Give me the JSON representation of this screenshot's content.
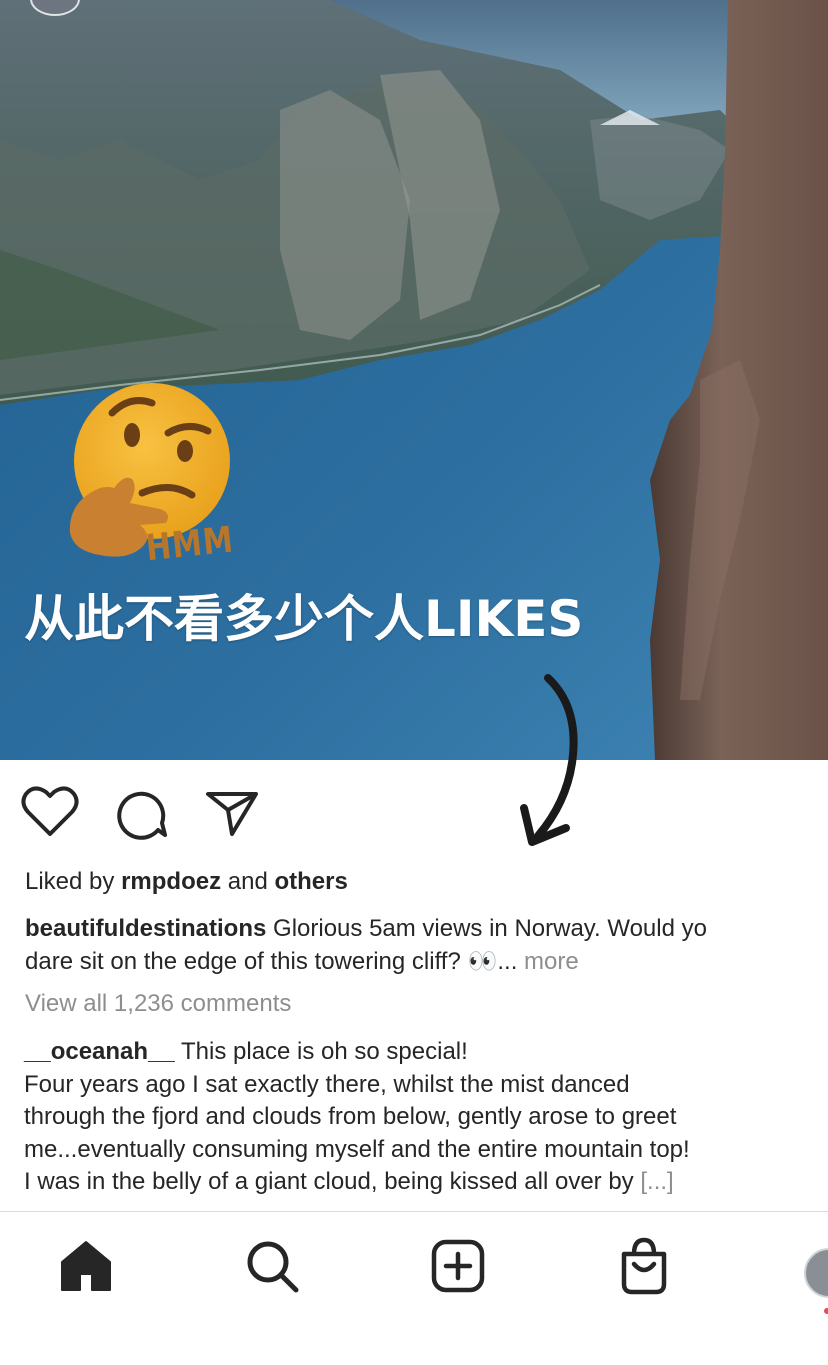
{
  "post": {
    "overlay_caption": "从此不看多少个人LIKES",
    "sticker_text": "HMM",
    "liked_by_prefix": "Liked by",
    "liked_by_user": "rmpdoez",
    "liked_by_and": "and",
    "liked_by_others": "others",
    "caption_user": "beautifuldestinations",
    "caption_line1": "Glorious 5am views in Norway. Would yo",
    "caption_line2": "dare sit on the edge of this towering cliff? 👀...",
    "caption_more": "more",
    "view_all_comments": "View all 1,236 comments",
    "comment_user": "__oceanah__",
    "comment_line1": "This place is oh so special!",
    "comment_line2": "Four years ago I sat exactly there,  whilst the mist danced",
    "comment_line3": "through the fjord and clouds from below, gently arose to greet",
    "comment_line4": "me...eventually consuming myself and the entire mountain top!",
    "comment_line5": "I was in the belly of a giant cloud, being kissed all over by",
    "comment_truncated": "[...]"
  },
  "icons": {
    "like": "heart-icon",
    "comment": "comment-bubble-icon",
    "share": "paper-plane-icon",
    "home": "home-icon",
    "search": "search-icon",
    "create": "plus-square-icon",
    "shop": "shopping-bag-icon"
  },
  "colors": {
    "text": "#262626",
    "secondary": "#8e8e8e",
    "sticker": "#b7762a",
    "notification": "#ed4956"
  }
}
